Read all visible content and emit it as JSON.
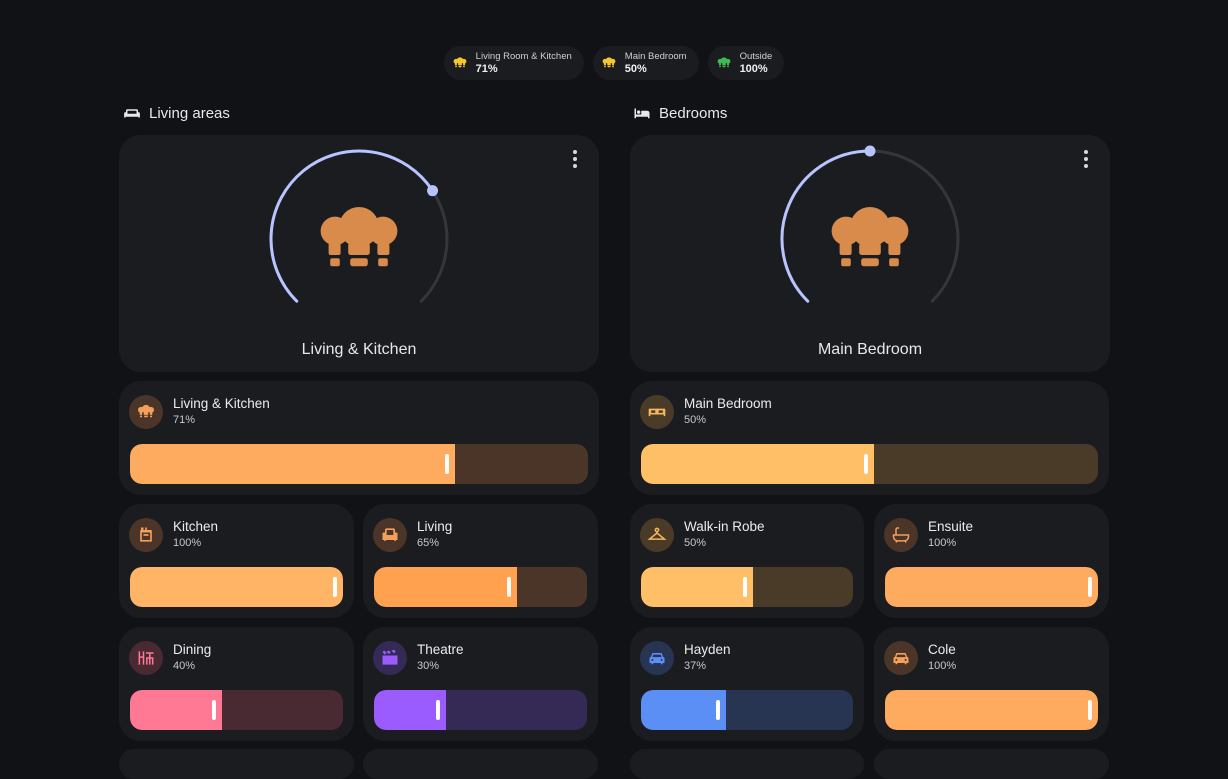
{
  "chips": [
    {
      "name": "Living Room & Kitchen",
      "value": "71%",
      "icon": "lightbulb-group-icon",
      "color": "#f7c52f"
    },
    {
      "name": "Main Bedroom",
      "value": "50%",
      "icon": "lightbulb-group-icon",
      "color": "#f7c52f"
    },
    {
      "name": "Outside",
      "value": "100%",
      "icon": "lightbulb-group-icon",
      "color": "#3fb950"
    }
  ],
  "sections": {
    "living": {
      "title": "Living areas",
      "icon": "sofa-icon"
    },
    "bedrooms": {
      "title": "Bedrooms",
      "icon": "bed-icon"
    }
  },
  "heroes": {
    "living": {
      "name": "Living & Kitchen",
      "level": 0.71,
      "icon": "lightbulb-group-icon",
      "accent": "#b8c4ff",
      "bulb_color": "#d88b4a"
    },
    "bedroom": {
      "name": "Main Bedroom",
      "level": 0.5,
      "icon": "lightbulb-group-icon",
      "accent": "#b8c4ff",
      "bulb_color": "#d88b4a"
    }
  },
  "tiles": {
    "living_kitchen": {
      "name": "Living & Kitchen",
      "value": "71%",
      "level": 0.71,
      "icon": "lightbulb-group-icon",
      "fill": "#ffab5f",
      "track": "#4a3528",
      "icon_bg": "#4a3528",
      "icon_color": "#f2a05b"
    },
    "main_bedroom": {
      "name": "Main Bedroom",
      "value": "50%",
      "level": 0.51,
      "icon": "bed-icon",
      "fill": "#ffbf66",
      "track": "#4a3a28",
      "icon_bg": "#4a3a28",
      "icon_color": "#f5b760"
    },
    "kitchen": {
      "name": "Kitchen",
      "value": "100%",
      "level": 1.0,
      "icon": "stove-icon",
      "fill": "#ffb466",
      "track": "#4a3528",
      "icon_bg": "#4a3528",
      "icon_color": "#f2a05b"
    },
    "living": {
      "name": "Living",
      "value": "65%",
      "level": 0.67,
      "icon": "armchair-icon",
      "fill": "#ffa14f",
      "track": "#4a3528",
      "icon_bg": "#4a3528",
      "icon_color": "#f2a05b"
    },
    "walkin": {
      "name": "Walk-in Robe",
      "value": "50%",
      "level": 0.53,
      "icon": "hanger-icon",
      "fill": "#ffbf66",
      "track": "#4a3a28",
      "icon_bg": "#4a3a28",
      "icon_color": "#f5b760"
    },
    "ensuite": {
      "name": "Ensuite",
      "value": "100%",
      "level": 1.0,
      "icon": "bathtub-icon",
      "fill": "#ffab5f",
      "track": "#4a3528",
      "icon_bg": "#4a3528",
      "icon_color": "#f2a05b"
    },
    "dining": {
      "name": "Dining",
      "value": "40%",
      "level": 0.43,
      "icon": "dining-table-icon",
      "fill": "#ff7894",
      "track": "#4a2a32",
      "icon_bg": "#4a2a32",
      "icon_color": "#ff7894"
    },
    "theatre": {
      "name": "Theatre",
      "value": "30%",
      "level": 0.34,
      "icon": "clapperboard-icon",
      "fill": "#9a5cff",
      "track": "#352a55",
      "icon_bg": "#352a55",
      "icon_color": "#9a5cff"
    },
    "hayden": {
      "name": "Hayden",
      "value": "37%",
      "level": 0.4,
      "icon": "car-icon",
      "fill": "#5b8ff5",
      "track": "#283552",
      "icon_bg": "#283552",
      "icon_color": "#5b8ff5"
    },
    "cole": {
      "name": "Cole",
      "value": "100%",
      "level": 1.0,
      "icon": "car-icon",
      "fill": "#ffab5f",
      "track": "#4a3528",
      "icon_bg": "#4a3528",
      "icon_color": "#f2a05b"
    }
  }
}
